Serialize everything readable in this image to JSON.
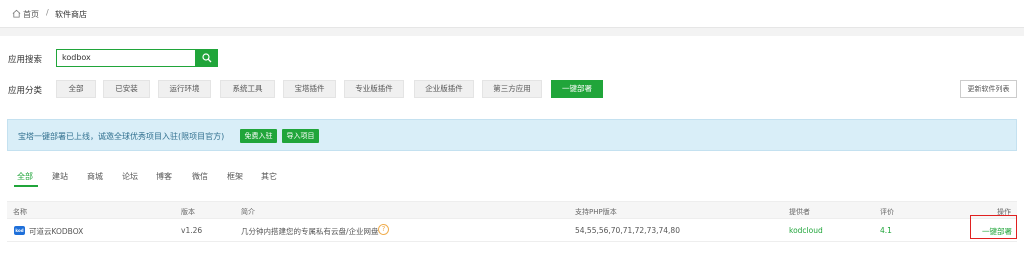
{
  "breadcrumb": {
    "home": "首页",
    "separator": "/",
    "current": "软件商店"
  },
  "search": {
    "label": "应用搜索",
    "value": "kodbox"
  },
  "categories": {
    "label": "应用分类",
    "items": [
      "全部",
      "已安装",
      "运行环境",
      "系统工具",
      "宝塔插件",
      "专业版插件",
      "企业版插件",
      "第三方应用",
      "一键部署"
    ],
    "active": "一键部署"
  },
  "refresh_label": "更新软件列表",
  "notice": {
    "text": "宝塔一键部署已上线，诚邀全球优秀项目入驻(限项目官方)",
    "btn_join": "免费入驻",
    "btn_import": "导入项目"
  },
  "tabs": [
    "全部",
    "建站",
    "商城",
    "论坛",
    "博客",
    "微信",
    "框架",
    "其它"
  ],
  "table": {
    "headers": [
      "名称",
      "版本",
      "简介",
      "支持PHP版本",
      "提供者",
      "评价",
      "操作"
    ],
    "rows": [
      {
        "logo": "kod",
        "name": "可道云KODBOX",
        "version": "v1.26",
        "desc": "几分钟内搭建您的专属私有云盘/企业网盘",
        "php": "54,55,56,70,71,72,73,74,80",
        "provider": "kodcloud",
        "rating": "4.1",
        "action": "一键部署"
      }
    ]
  },
  "colors": {
    "accent": "#20a53a",
    "notice_bg": "#d9eef8",
    "highlight": "#e02020"
  }
}
